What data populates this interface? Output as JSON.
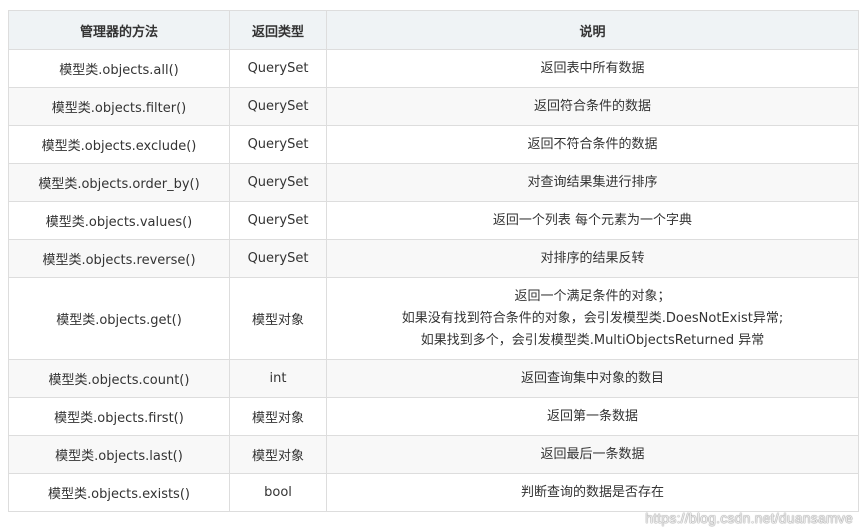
{
  "table": {
    "headers": [
      "管理器的方法",
      "返回类型",
      "说明"
    ],
    "rows": [
      {
        "method": "模型类.objects.all()",
        "return_type": "QuerySet",
        "desc": [
          "返回表中所有数据"
        ]
      },
      {
        "method": "模型类.objects.filter()",
        "return_type": "QuerySet",
        "desc": [
          "返回符合条件的数据"
        ]
      },
      {
        "method": "模型类.objects.exclude()",
        "return_type": "QuerySet",
        "desc": [
          "返回不符合条件的数据"
        ]
      },
      {
        "method": "模型类.objects.order_by()",
        "return_type": "QuerySet",
        "desc": [
          "对查询结果集进行排序"
        ]
      },
      {
        "method": "模型类.objects.values()",
        "return_type": "QuerySet",
        "desc": [
          "返回一个列表 每个元素为一个字典"
        ]
      },
      {
        "method": "模型类.objects.reverse()",
        "return_type": "QuerySet",
        "desc": [
          "对排序的结果反转"
        ]
      },
      {
        "method": "模型类.objects.get()",
        "return_type": "模型对象",
        "desc": [
          "返回一个满足条件的对象；",
          "如果没有找到符合条件的对象，会引发模型类.DoesNotExist异常;",
          "如果找到多个，会引发模型类.MultiObjectsReturned 异常"
        ]
      },
      {
        "method": "模型类.objects.count()",
        "return_type": "int",
        "desc": [
          "返回查询集中对象的数目"
        ]
      },
      {
        "method": "模型类.objects.first()",
        "return_type": "模型对象",
        "desc": [
          "返回第一条数据"
        ]
      },
      {
        "method": "模型类.objects.last()",
        "return_type": "模型对象",
        "desc": [
          "返回最后一条数据"
        ]
      },
      {
        "method": "模型类.objects.exists()",
        "return_type": "bool",
        "desc": [
          "判断查询的数据是否存在"
        ]
      }
    ]
  },
  "watermark": "https://blog.csdn.net/duansamve",
  "colors": {
    "header_bg": "#eff3f5",
    "stripe_bg": "#f8f8f8",
    "border": "#dddddd",
    "text": "#333333"
  }
}
